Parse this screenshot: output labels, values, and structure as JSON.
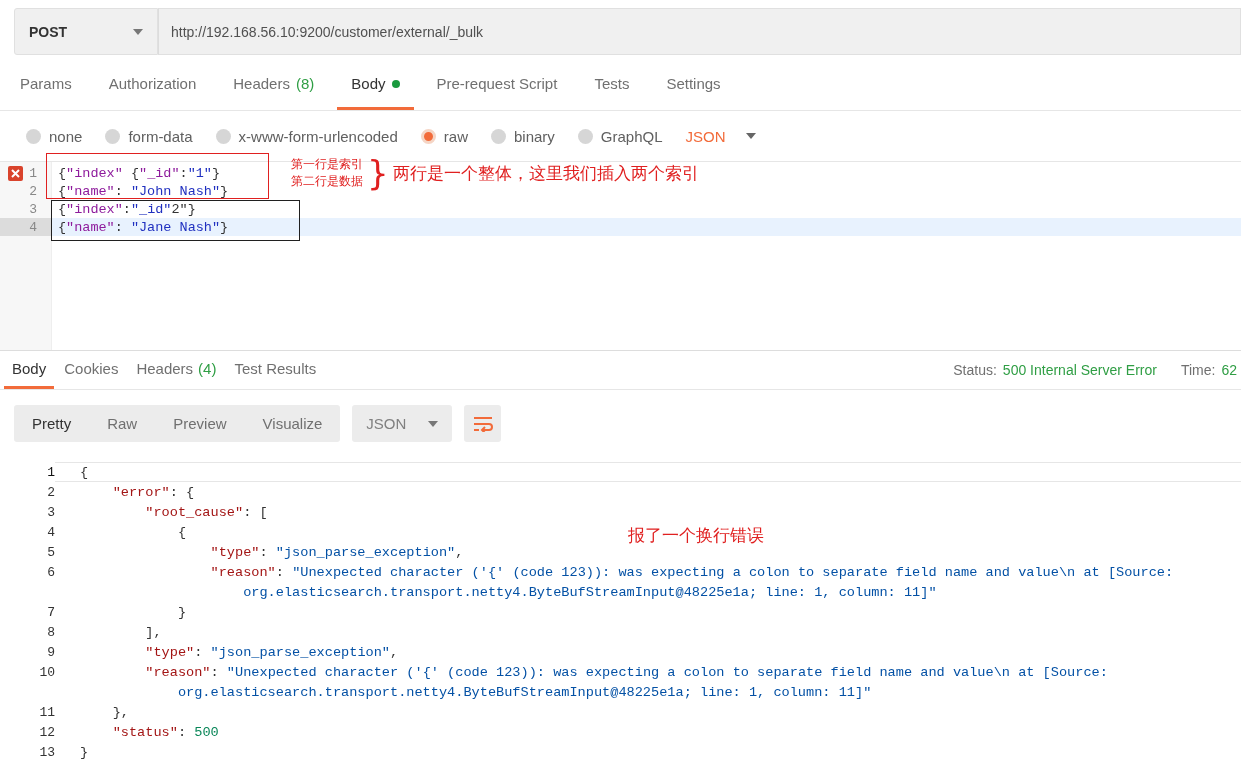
{
  "request": {
    "method": "POST",
    "url": "http://192.168.56.10:9200/customer/external/_bulk"
  },
  "request_tabs": [
    {
      "label": "Params",
      "indicator": false,
      "selected": false
    },
    {
      "label": "Authorization",
      "indicator": false,
      "selected": false
    },
    {
      "label": "Headers",
      "count": "(8)",
      "indicator": false,
      "selected": false
    },
    {
      "label": "Body",
      "indicator": true,
      "selected": true
    },
    {
      "label": "Pre-request Script",
      "indicator": false,
      "selected": false
    },
    {
      "label": "Tests",
      "indicator": false,
      "selected": false
    },
    {
      "label": "Settings",
      "indicator": false,
      "selected": false
    }
  ],
  "body_types": [
    {
      "label": "none",
      "selected": false
    },
    {
      "label": "form-data",
      "selected": false
    },
    {
      "label": "x-www-form-urlencoded",
      "selected": false
    },
    {
      "label": "raw",
      "selected": true
    },
    {
      "label": "binary",
      "selected": false
    },
    {
      "label": "GraphQL",
      "selected": false
    }
  ],
  "body_format": "JSON",
  "editor_lines": [
    {
      "number": "1",
      "error": true,
      "active": false,
      "segments": [
        {
          "kind": "punct",
          "text": "{"
        },
        {
          "kind": "key",
          "text": "\"index\""
        },
        {
          "kind": "punct",
          "text": " {"
        },
        {
          "kind": "key",
          "text": "\"_id\""
        },
        {
          "kind": "punct",
          "text": ":"
        },
        {
          "kind": "string",
          "text": "\"1\""
        },
        {
          "kind": "punct",
          "text": "}"
        }
      ]
    },
    {
      "number": "2",
      "error": false,
      "active": false,
      "segments": [
        {
          "kind": "punct",
          "text": "{"
        },
        {
          "kind": "key",
          "text": "\"name\""
        },
        {
          "kind": "punct",
          "text": ": "
        },
        {
          "kind": "string",
          "text": "\"John Nash\""
        },
        {
          "kind": "punct",
          "text": "}"
        }
      ]
    },
    {
      "number": "3",
      "error": false,
      "active": false,
      "segments": [
        {
          "kind": "punct",
          "text": "{"
        },
        {
          "kind": "key",
          "text": "\"index\""
        },
        {
          "kind": "punct",
          "text": ":"
        },
        {
          "kind": "string",
          "text": "\"_id\""
        },
        {
          "kind": "punct",
          "text": "2\"}"
        }
      ]
    },
    {
      "number": "4",
      "error": false,
      "active": true,
      "segments": [
        {
          "kind": "punct",
          "text": "{"
        },
        {
          "kind": "key",
          "text": "\"name\""
        },
        {
          "kind": "punct",
          "text": ": "
        },
        {
          "kind": "string",
          "text": "\"Jane Nash\""
        },
        {
          "kind": "punct",
          "text": "}"
        }
      ]
    }
  ],
  "editor_notes": {
    "lines": [
      "第一行是索引",
      "第二行是数据"
    ],
    "brace": "}",
    "summary": "两行是一个整体，这里我们插入两个索引"
  },
  "response_tabs": [
    {
      "label": "Body",
      "selected": true
    },
    {
      "label": "Cookies",
      "selected": false
    },
    {
      "label": "Headers",
      "count": "(4)",
      "selected": false
    },
    {
      "label": "Test Results",
      "selected": false
    }
  ],
  "response_status": {
    "status_label": "Status:",
    "status": "500 Internal Server Error",
    "time_label": "Time:",
    "time": "62"
  },
  "view_modes": [
    {
      "label": "Pretty",
      "selected": true
    },
    {
      "label": "Raw",
      "selected": false
    },
    {
      "label": "Preview",
      "selected": false
    },
    {
      "label": "Visualize",
      "selected": false
    }
  ],
  "response_format": "JSON",
  "response_lines": [
    {
      "number": "1",
      "current": true,
      "segments": [
        {
          "kind": "punct",
          "text": "{"
        }
      ]
    },
    {
      "number": "2",
      "current": false,
      "segments": [
        {
          "kind": "key",
          "text": "    \"error\""
        },
        {
          "kind": "punct",
          "text": ": {"
        }
      ]
    },
    {
      "number": "3",
      "current": false,
      "segments": [
        {
          "kind": "key",
          "text": "        \"root_cause\""
        },
        {
          "kind": "punct",
          "text": ": ["
        }
      ]
    },
    {
      "number": "4",
      "current": false,
      "segments": [
        {
          "kind": "punct",
          "text": "            {"
        }
      ]
    },
    {
      "number": "5",
      "current": false,
      "segments": [
        {
          "kind": "key",
          "text": "                \"type\""
        },
        {
          "kind": "punct",
          "text": ": "
        },
        {
          "kind": "string",
          "text": "\"json_parse_exception\""
        },
        {
          "kind": "punct",
          "text": ","
        }
      ]
    },
    {
      "number": "6",
      "current": false,
      "segments": [
        {
          "kind": "key",
          "text": "                \"reason\""
        },
        {
          "kind": "punct",
          "text": ": "
        },
        {
          "kind": "string",
          "text": "\"Unexpected character ('{' (code 123)): was expecting a colon to separate field name and value\\n at [Source:"
        }
      ],
      "wrapped": [
        {
          "kind": "string",
          "text": "                    org.elasticsearch.transport.netty4.ByteBufStreamInput@48225e1a; line: 1, column: 11]\""
        }
      ]
    },
    {
      "number": "7",
      "current": false,
      "segments": [
        {
          "kind": "punct",
          "text": "            }"
        }
      ]
    },
    {
      "number": "8",
      "current": false,
      "segments": [
        {
          "kind": "punct",
          "text": "        ],"
        }
      ]
    },
    {
      "number": "9",
      "current": false,
      "segments": [
        {
          "kind": "key",
          "text": "        \"type\""
        },
        {
          "kind": "punct",
          "text": ": "
        },
        {
          "kind": "string",
          "text": "\"json_parse_exception\""
        },
        {
          "kind": "punct",
          "text": ","
        }
      ]
    },
    {
      "number": "10",
      "current": false,
      "segments": [
        {
          "kind": "key",
          "text": "        \"reason\""
        },
        {
          "kind": "punct",
          "text": ": "
        },
        {
          "kind": "string",
          "text": "\"Unexpected character ('{' (code 123)): was expecting a colon to separate field name and value\\n at [Source:"
        }
      ],
      "wrapped": [
        {
          "kind": "string",
          "text": "            org.elasticsearch.transport.netty4.ByteBufStreamInput@48225e1a; line: 1, column: 11]\""
        }
      ]
    },
    {
      "number": "11",
      "current": false,
      "segments": [
        {
          "kind": "punct",
          "text": "    },"
        }
      ]
    },
    {
      "number": "12",
      "current": false,
      "segments": [
        {
          "kind": "key",
          "text": "    \"status\""
        },
        {
          "kind": "punct",
          "text": ": "
        },
        {
          "kind": "number",
          "text": "500"
        }
      ]
    },
    {
      "number": "13",
      "current": false,
      "segments": [
        {
          "kind": "punct",
          "text": "}"
        }
      ]
    }
  ],
  "response_note": "报了一个换行错误"
}
